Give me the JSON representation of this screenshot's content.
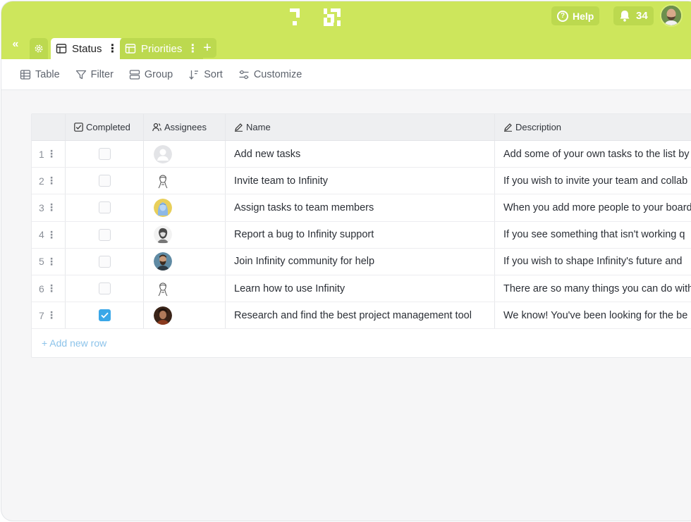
{
  "header": {
    "help_label": "Help",
    "notification_count": "34"
  },
  "tabs": {
    "collapse_icon": "double-chevron-left-icon",
    "settings_icon": "gear-icon",
    "items": [
      {
        "label": "Status",
        "active": true
      },
      {
        "label": "Priorities",
        "active": false
      }
    ],
    "add_icon": "plus-icon"
  },
  "toolbar": {
    "table": "Table",
    "filter": "Filter",
    "group": "Group",
    "sort": "Sort",
    "customize": "Customize"
  },
  "grid": {
    "headers": {
      "completed": "Completed",
      "assignees": "Assignees",
      "name": "Name",
      "description": "Description"
    },
    "rows": [
      {
        "num": "1",
        "completed": false,
        "avatar": "placeholder",
        "name": "Add new tasks",
        "description": "Add some of your own tasks to the list by"
      },
      {
        "num": "2",
        "completed": false,
        "avatar": "sketch-a",
        "name": "Invite team to Infinity",
        "description": "If you wish to invite your team and collab"
      },
      {
        "num": "3",
        "completed": false,
        "avatar": "blue-a",
        "name": "Assign tasks to team members",
        "description": "When you add more people to your board"
      },
      {
        "num": "4",
        "completed": false,
        "avatar": "sketch-b",
        "name": "Report a bug to Infinity support",
        "description": "If you see something that isn't working q"
      },
      {
        "num": "5",
        "completed": false,
        "avatar": "photo-a",
        "name": "Join Infinity community for help",
        "description": "If you wish to shape Infinity's future and"
      },
      {
        "num": "6",
        "completed": false,
        "avatar": "sketch-a",
        "name": "Learn how to use Infinity",
        "description": "There are so many things you can do with"
      },
      {
        "num": "7",
        "completed": true,
        "avatar": "photo-b",
        "name": "Research and find the best project management tool",
        "description": "We know! You've been looking for the be"
      }
    ],
    "add_row_label": "+ Add new row"
  },
  "colors": {
    "brand": "#cde65c",
    "brand_dark": "#bcd94f",
    "check": "#3aa7e8",
    "link": "#8cc3ea"
  }
}
